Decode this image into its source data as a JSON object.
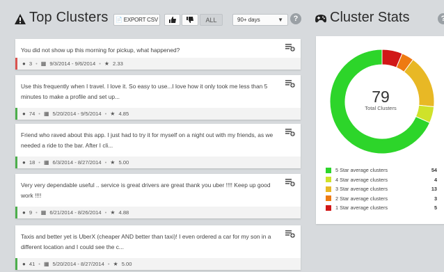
{
  "header": {
    "title": "Top Clusters",
    "export_label": "EXPORT CSV",
    "all_label": "ALL",
    "range_select": "90+ days"
  },
  "cards": [
    {
      "text": "You did not show up this morning for pickup, what happened?",
      "count": "3",
      "dates": "9/3/2014 - 9/6/2014",
      "rating": "2.33",
      "bar_color": "#d9534f"
    },
    {
      "text": "Use this frequently when I travel. I love it. So easy to use...I love how it only took me less than 5 minutes to make a profile and set up...",
      "count": "74",
      "dates": "5/20/2014 - 9/5/2014",
      "rating": "4.85",
      "bar_color": "#4cae4c"
    },
    {
      "text": "Friend who raved about this app. I just had to try it for myself on a night out with my friends, as we needed a ride to the bar. After I cli...",
      "count": "18",
      "dates": "6/3/2014 - 8/27/2014",
      "rating": "5.00",
      "bar_color": "#4cae4c"
    },
    {
      "text": "Very very dependable useful .. service is great drivers are great thank you uber !!!! Keep up good work !!!!",
      "count": "9",
      "dates": "6/21/2014 - 8/26/2014",
      "rating": "4.88",
      "bar_color": "#4cae4c"
    },
    {
      "text": "Taxis and better yet is UberX (cheaper AND better than taxi)! I even ordered a car for my son in a different location and I could see the c...",
      "count": "41",
      "dates": "5/20/2014 - 8/27/2014",
      "rating": "5.00",
      "bar_color": "#4cae4c"
    }
  ],
  "stats": {
    "title": "Cluster Stats",
    "total": "79",
    "total_label": "Total Clusters",
    "legend": [
      {
        "label": "5 Star average clusters",
        "count": "54",
        "color": "#2dd52a"
      },
      {
        "label": "4 Star average clusters",
        "count": "4",
        "color": "#cfe22a"
      },
      {
        "label": "3 Star average clusters",
        "count": "13",
        "color": "#e8b825"
      },
      {
        "label": "2 Star average clusters",
        "count": "3",
        "color": "#ee7a12"
      },
      {
        "label": "1 Star average clusters",
        "count": "5",
        "color": "#d11717"
      }
    ]
  },
  "chart_data": {
    "type": "pie",
    "categories": [
      "5 Star average clusters",
      "4 Star average clusters",
      "3 Star average clusters",
      "2 Star average clusters",
      "1 Star average clusters"
    ],
    "values": [
      54,
      4,
      13,
      3,
      5
    ],
    "colors": [
      "#2dd52a",
      "#cfe22a",
      "#e8b825",
      "#ee7a12",
      "#d11717"
    ],
    "title": "Cluster Stats"
  }
}
